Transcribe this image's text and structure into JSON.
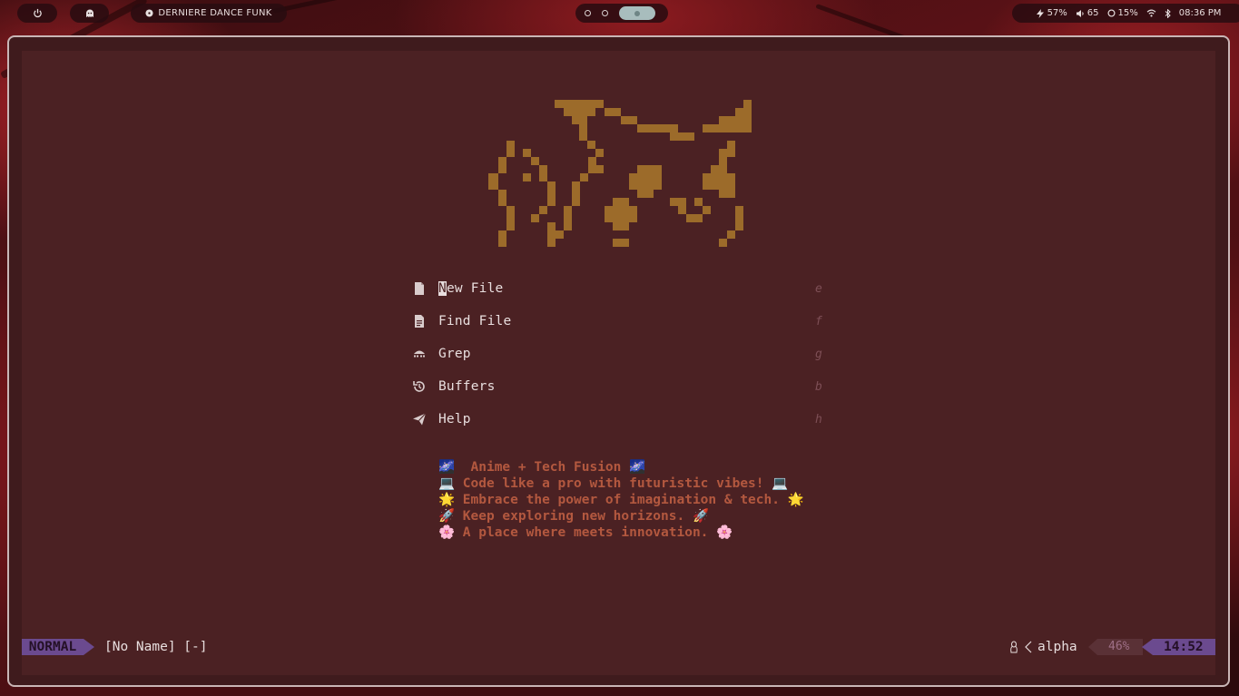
{
  "topbar": {
    "power_icon": "power-icon",
    "ghost_icon": "ghost-icon",
    "media_title": "DERNIERE DANCE FUNK",
    "media_icon": "music-disc-icon",
    "workspaces": [
      "1",
      "2",
      "3"
    ],
    "active_workspace": 3,
    "system": {
      "battery": "57%",
      "volume": "65",
      "cpu": "15%",
      "time": "08:36 PM"
    }
  },
  "dashboard": {
    "menu": [
      {
        "icon": "new-file-icon",
        "label": "New File",
        "key": "e"
      },
      {
        "icon": "find-file-icon",
        "label": "Find File",
        "key": "f"
      },
      {
        "icon": "grep-icon",
        "label": "Grep",
        "key": "g"
      },
      {
        "icon": "history-icon",
        "label": "Buffers",
        "key": "b"
      },
      {
        "icon": "send-icon",
        "label": "Help",
        "key": "h"
      }
    ],
    "quotes": [
      "🌌  Anime + Tech Fusion 🌌",
      "💻 Code like a pro with futuristic vibes! 💻",
      "🌟 Embrace the power of imagination & tech. 🌟",
      "🚀 Keep exploring new horizons. 🚀",
      "🌸 A place where meets innovation. 🌸"
    ]
  },
  "statusline": {
    "mode": "NORMAL",
    "filename": "[No Name] [-]",
    "filetype": "alpha",
    "filetype_icon": "linux-icon",
    "progress": "46%",
    "clock": "14:52"
  },
  "colors": {
    "editor_bg": "#4b2123",
    "accent_purple": "#6b4a8f",
    "logo_gold": "#9c6b2a",
    "quote_orange": "#b3583f"
  }
}
